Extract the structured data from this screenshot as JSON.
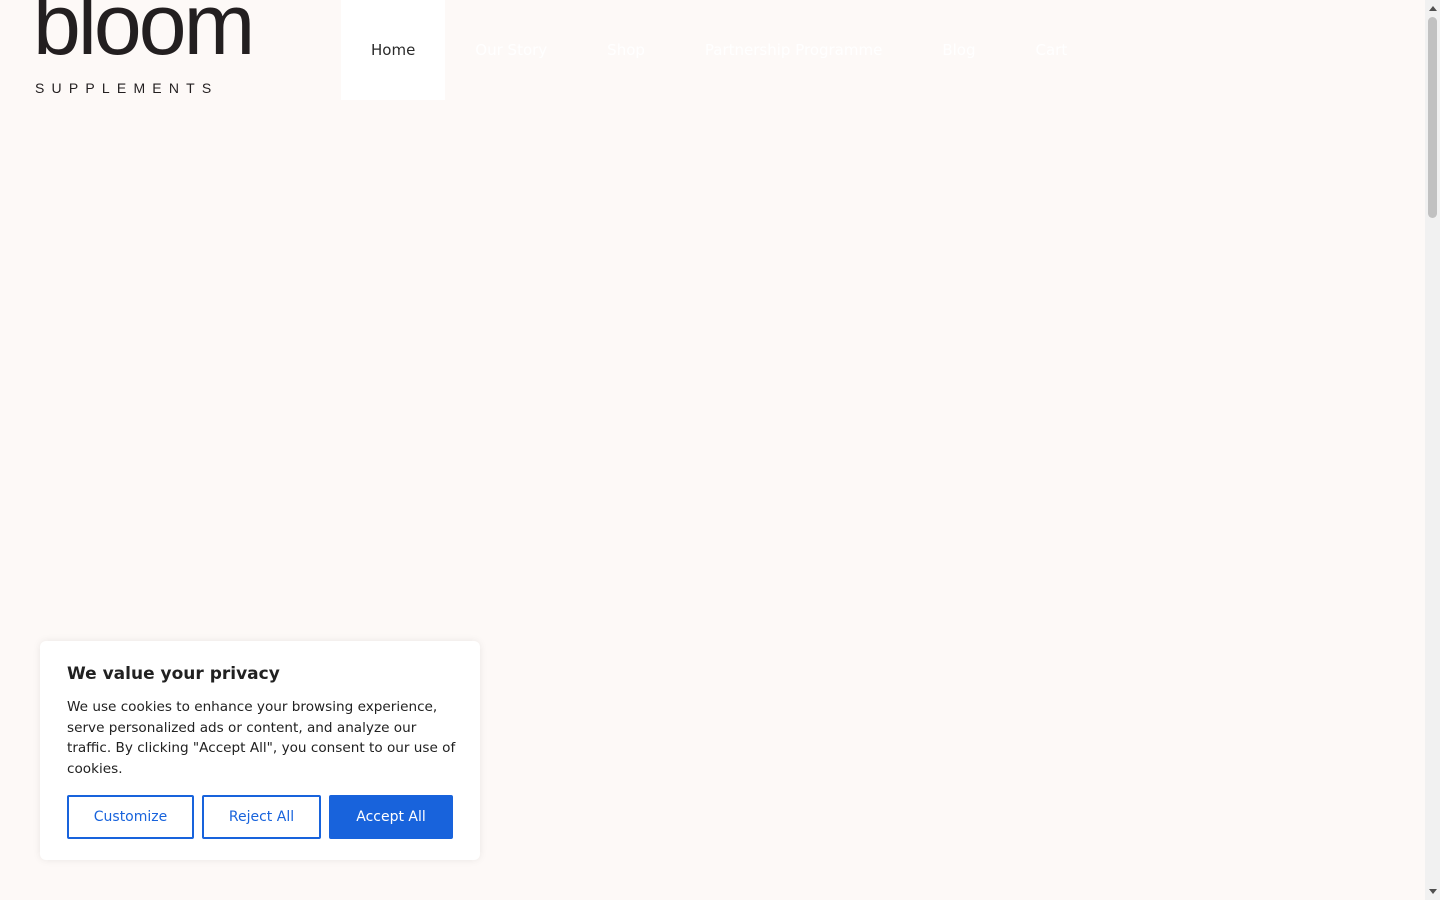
{
  "logo": {
    "word": "bloom",
    "subtitle": "SUPPLEMENTS"
  },
  "nav": {
    "items": [
      {
        "label": "Home"
      },
      {
        "label": "Our Story"
      },
      {
        "label": "Shop"
      },
      {
        "label": "Partnership Programme"
      },
      {
        "label": "Blog"
      },
      {
        "label": "Cart"
      }
    ],
    "active": "Home"
  },
  "cookie_banner": {
    "title": "We value your privacy",
    "body": "We use cookies to enhance your browsing experience, serve personalized ads or content, and analyze our traffic. By clicking \"Accept All\", you consent to our use of cookies.",
    "customize_label": "Customize",
    "reject_label": "Reject All",
    "accept_label": "Accept All"
  },
  "colors": {
    "page_background": "#fdf9f7",
    "accent_blue": "#1863dc",
    "logo_text": "#231f20"
  }
}
